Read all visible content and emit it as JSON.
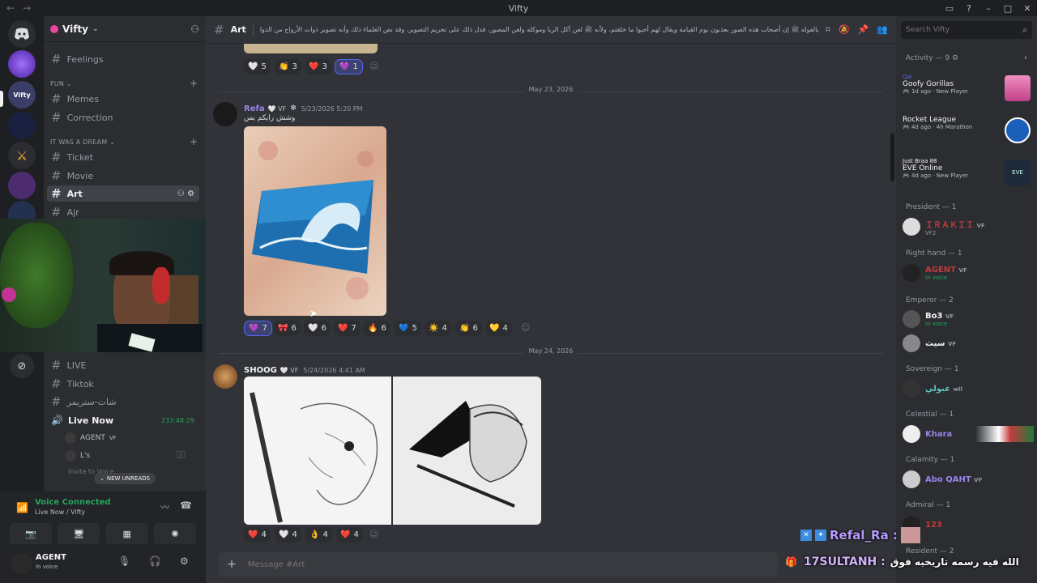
{
  "window": {
    "title": "Vifty"
  },
  "server": {
    "name": "Vifty"
  },
  "channels_top": [
    {
      "name": "Feelings"
    }
  ],
  "categories": {
    "fun": "FUN",
    "dream": "IT WAS A DREAM"
  },
  "channels_fun": [
    {
      "name": "Memes"
    },
    {
      "name": "Correction"
    }
  ],
  "channels_dream": [
    {
      "name": "Ticket"
    },
    {
      "name": "Movie"
    },
    {
      "name": "Art"
    },
    {
      "name": "Ajr"
    }
  ],
  "channels_lower": [
    {
      "name": "LIVE"
    },
    {
      "name": "Tiktok"
    },
    {
      "name": "شات-ستريمر"
    }
  ],
  "live_now": {
    "name": "Live Now",
    "timer": "233:48:29"
  },
  "voice_users": [
    {
      "name": "AGENT",
      "tag": "VF"
    },
    {
      "name": "L's"
    }
  ],
  "invite_label": "Invite to Voice",
  "new_unreads": "NEW UNREADS",
  "voice": {
    "status": "Voice Connected",
    "location": "Live Now / Vifty"
  },
  "user": {
    "name": "AGENT",
    "status": "In voice"
  },
  "chat_header": {
    "channel": "Art",
    "topic": "يالفوله ﷺ إن أصحاب هذه الصور يعذبون يوم القيامة ويقال لهم أحيوا ما خلقتم، ولأنه ﷺ لعن آكل الربا وموكله ولعن المصور، فدل ذلك على تحريم التصوير، وقد نص العلماء ذلك وأنه تصوير ذوات الأرواح من الدواب والإنسان والطيور"
  },
  "search": {
    "placeholder": "Search Vifty"
  },
  "top_reactions": [
    {
      "emoji": "🤍",
      "count": "5"
    },
    {
      "emoji": "👏",
      "count": "3"
    },
    {
      "emoji": "❤️",
      "count": "3"
    },
    {
      "emoji": "💜",
      "count": "1"
    }
  ],
  "dates": [
    "May 23, 2026",
    "May 24, 2026"
  ],
  "messages": [
    {
      "author": "Refa",
      "tag": "VF",
      "timestamp": "5/23/2026 5:20 PM",
      "text": "وشش رايكم بس",
      "reactions": [
        {
          "emoji": "💜",
          "count": "7"
        },
        {
          "emoji": "🎀",
          "count": "6"
        },
        {
          "emoji": "🤍",
          "count": "6"
        },
        {
          "emoji": "❤️",
          "count": "7"
        },
        {
          "emoji": "🔥",
          "count": "6"
        },
        {
          "emoji": "💙",
          "count": "5"
        },
        {
          "emoji": "☀️",
          "count": "4"
        },
        {
          "emoji": "👏",
          "count": "6"
        },
        {
          "emoji": "💛",
          "count": "4"
        }
      ]
    },
    {
      "author": "SHOOG",
      "tag": "VF",
      "timestamp": "5/24/2026 4:41 AM",
      "text": "",
      "reactions": [
        {
          "emoji": "❤️",
          "count": "4"
        },
        {
          "emoji": "🤍",
          "count": "4"
        },
        {
          "emoji": "👌",
          "count": "4"
        },
        {
          "emoji": "❤️",
          "count": "4"
        }
      ]
    }
  ],
  "composer": {
    "placeholder": "Message #Art"
  },
  "activity": {
    "header": "Activity — 9",
    "items": [
      {
        "user": "Qai.",
        "game": "Goofy Gorillas",
        "time": "1d ago",
        "badge": "New Player"
      },
      {
        "user": "",
        "game": "Rocket League",
        "time": "4d ago",
        "badge": "4h Marathon"
      },
      {
        "user": "Just Braa 88",
        "game": "EVE Online",
        "time": "4d ago",
        "badge": "New Player"
      }
    ]
  },
  "member_groups": [
    {
      "label": "President — 1",
      "members": [
        {
          "name": "ＩＲＡＫＩＩ",
          "tag": "VF",
          "sub": "VF2"
        }
      ]
    },
    {
      "label": "Right hand — 1",
      "members": [
        {
          "name": "AGENT",
          "tag": "VF",
          "sub": "In voice"
        }
      ]
    },
    {
      "label": "Emperor — 2",
      "members": [
        {
          "name": "Bo3",
          "tag": "VF",
          "sub": "In voice"
        },
        {
          "name": "سيث",
          "tag": "VF",
          "sub": ""
        }
      ]
    },
    {
      "label": "Sovereign — 1",
      "members": [
        {
          "name": "عبولي",
          "tag": "wll",
          "sub": ""
        }
      ]
    },
    {
      "label": "Celestial — 1",
      "members": [
        {
          "name": "Khara",
          "tag": "",
          "sub": ""
        }
      ]
    },
    {
      "label": "Calamity — 1",
      "members": [
        {
          "name": "Abo QAHT",
          "tag": "VF",
          "sub": ""
        }
      ]
    },
    {
      "label": "Admiral — 1",
      "members": [
        {
          "name": "123",
          "tag": "",
          "sub": ""
        }
      ]
    },
    {
      "label": "Resident — 2",
      "members": []
    }
  ],
  "stream_overlay": {
    "chat_user": "Refal_Ra :",
    "chat_user2": "17SULTANH :",
    "chat_msg2": "الله فيه رسمه تاريخيه فوق"
  },
  "colors": {
    "accent": "#5865f2",
    "green": "#23a55a",
    "bg": "#313338"
  }
}
